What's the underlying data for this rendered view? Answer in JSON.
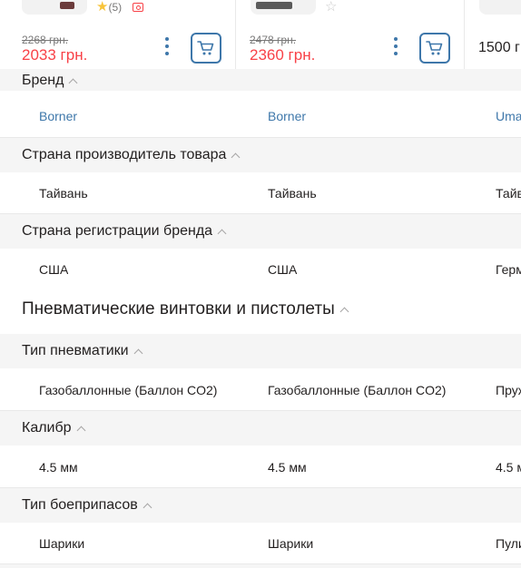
{
  "products": [
    {
      "rating_count": "(5)",
      "old_price": "2268 грн.",
      "price": "2033 грн."
    },
    {
      "old_price": "2478 грн.",
      "price": "2360 грн."
    },
    {
      "price": "1500 г"
    }
  ],
  "groups": [
    {
      "title": "Бренд",
      "values": [
        "Borner",
        "Borner",
        "Uma"
      ]
    },
    {
      "title": "Страна производитель товара",
      "values": [
        "Тайвань",
        "Тайвань",
        "Тайв"
      ]
    },
    {
      "title": "Страна регистрации бренда",
      "values": [
        "США",
        "США",
        "Герм"
      ]
    }
  ],
  "section": {
    "title": "Пневматические винтовки и пистолеты"
  },
  "section_groups": [
    {
      "title": "Тип пневматики",
      "values": [
        "Газобаллонные (Баллон CO2)",
        "Газобаллонные (Баллон CO2)",
        "Пруж"
      ]
    },
    {
      "title": "Калибр",
      "values": [
        "4.5 мм",
        "4.5 мм",
        "4.5 м"
      ]
    },
    {
      "title": "Тип боеприпасов",
      "values": [
        "Шарики",
        "Шарики",
        "Пули"
      ]
    }
  ],
  "colors": {
    "accent": "#3e77aa",
    "price": "#f84147",
    "star": "#f8c43a"
  }
}
